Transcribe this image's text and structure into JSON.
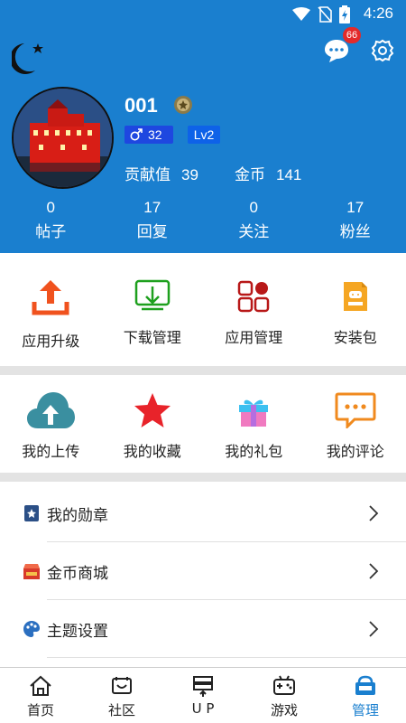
{
  "status_bar": {
    "time": "4:26"
  },
  "header": {
    "message_badge": "66",
    "username": "001",
    "gender_level": "32",
    "level": "Lv2",
    "contribution_label": "贡献值",
    "contribution_value": "39",
    "coins_label": "金币",
    "coins_value": "141",
    "counts": [
      {
        "num": "0",
        "label": "帖子"
      },
      {
        "num": "17",
        "label": "回复"
      },
      {
        "num": "0",
        "label": "关注"
      },
      {
        "num": "17",
        "label": "粉丝"
      }
    ]
  },
  "tools": [
    {
      "label": "应用升级",
      "icon": "upload-tray-icon"
    },
    {
      "label": "下载管理",
      "icon": "download-tray-icon"
    },
    {
      "label": "应用管理",
      "icon": "apps-grid-icon"
    },
    {
      "label": "安装包",
      "icon": "apk-file-icon"
    }
  ],
  "mine": [
    {
      "label": "我的上传",
      "icon": "cloud-upload-icon"
    },
    {
      "label": "我的收藏",
      "icon": "star-icon"
    },
    {
      "label": "我的礼包",
      "icon": "gift-icon"
    },
    {
      "label": "我的评论",
      "icon": "comment-icon"
    }
  ],
  "menu": [
    {
      "label": "我的勋章",
      "icon": "medal-icon"
    },
    {
      "label": "金币商城",
      "icon": "shop-icon"
    },
    {
      "label": "主题设置",
      "icon": "palette-icon"
    }
  ],
  "tabs": [
    {
      "label": "首页",
      "icon": "home-icon"
    },
    {
      "label": "社区",
      "icon": "community-icon"
    },
    {
      "label": "U P",
      "icon": "up-icon"
    },
    {
      "label": "游戏",
      "icon": "gamepad-icon"
    },
    {
      "label": "管理",
      "icon": "manage-icon"
    }
  ],
  "colors": {
    "brand": "#1a7fcf",
    "badge": "#e32a2a",
    "separator": "#e3e3e3"
  }
}
